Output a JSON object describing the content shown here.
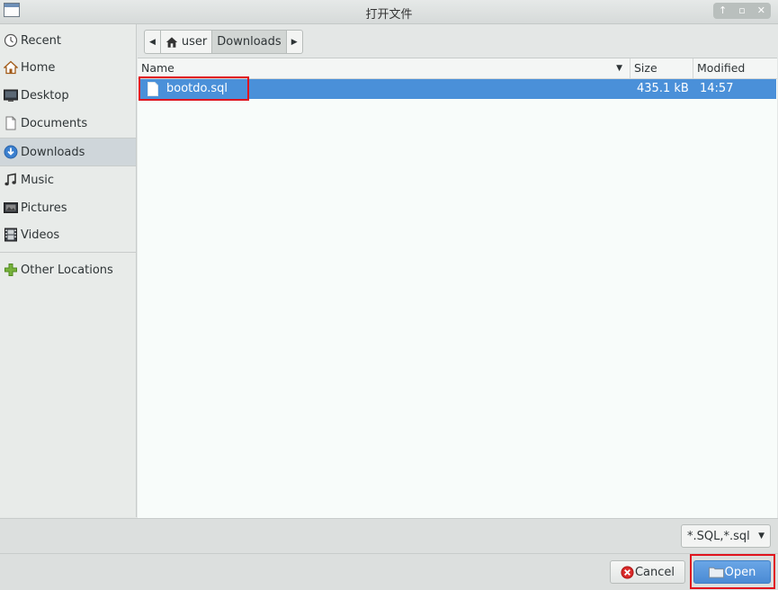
{
  "window": {
    "title": "打开文件"
  },
  "sidebar": {
    "items": [
      {
        "label": "Recent"
      },
      {
        "label": "Home"
      },
      {
        "label": "Desktop"
      },
      {
        "label": "Documents"
      },
      {
        "label": "Downloads",
        "active": true
      },
      {
        "label": "Music"
      },
      {
        "label": "Pictures"
      },
      {
        "label": "Videos"
      },
      {
        "label": "Other Locations"
      }
    ]
  },
  "pathbar": {
    "segments": [
      "user",
      "Downloads"
    ]
  },
  "columns": {
    "name": "Name",
    "size": "Size",
    "modified": "Modified"
  },
  "files": [
    {
      "name": "bootdo.sql",
      "size": "435.1 kB",
      "modified": "14:57",
      "selected": true
    }
  ],
  "filter": {
    "value": "*.SQL,*.sql"
  },
  "buttons": {
    "cancel": "Cancel",
    "open": "Open"
  },
  "colors": {
    "selection": "#4a90d9",
    "accent": "#4a8ad4",
    "highlight": "#e0141e"
  }
}
